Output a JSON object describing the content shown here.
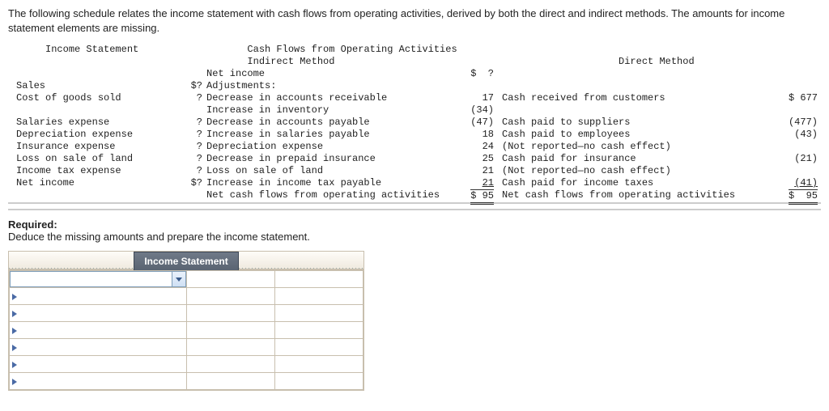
{
  "intro": "The following schedule relates the income statement with cash flows from operating activities, derived by both the direct and indirect methods. The amounts for income statement elements are missing.",
  "titles": {
    "cashflows": "Cash Flows from Operating Activities",
    "indirect": "Indirect Method",
    "direct": "Direct Method",
    "income_statement": "Income Statement"
  },
  "income_statement": {
    "rows": [
      {
        "label": "Sales",
        "value": "$?"
      },
      {
        "label": "Cost of goods sold",
        "value": "?"
      },
      {
        "label": "Salaries expense",
        "value": "?"
      },
      {
        "label": "Depreciation expense",
        "value": "?"
      },
      {
        "label": "Insurance expense",
        "value": "?"
      },
      {
        "label": "Loss on sale of land",
        "value": "?"
      },
      {
        "label": "Income tax expense",
        "value": "?"
      },
      {
        "label": "Net income",
        "value": "$?"
      }
    ]
  },
  "indirect": {
    "lines": [
      {
        "label": "Net income",
        "value": "$  ?"
      },
      {
        "label": "Adjustments:",
        "value": ""
      },
      {
        "label": "Decrease in accounts receivable",
        "value": "17"
      },
      {
        "label": "Increase in inventory",
        "value": "(34)"
      },
      {
        "label": "Decrease in accounts payable",
        "value": "(47)"
      },
      {
        "label": "Increase in salaries payable",
        "value": "18"
      },
      {
        "label": "Depreciation expense",
        "value": "24"
      },
      {
        "label": "Decrease in prepaid insurance",
        "value": "25"
      },
      {
        "label": "Loss on sale of land",
        "value": "21"
      },
      {
        "label": "Increase in income tax payable",
        "value": "21"
      },
      {
        "label": "Net cash flows from operating activities",
        "value": "$ 95"
      }
    ]
  },
  "direct": {
    "lines": [
      {
        "label": "Cash received from customers",
        "value": "$ 677"
      },
      {
        "label": "Cash paid to suppliers",
        "value": "(477)"
      },
      {
        "label": "Cash paid to employees",
        "value": "(43)"
      },
      {
        "label": "(Not reported—no cash effect)",
        "value": ""
      },
      {
        "label": "Cash paid for insurance",
        "value": "(21)"
      },
      {
        "label": "(Not reported—no cash effect)",
        "value": ""
      },
      {
        "label": "Cash paid for income taxes",
        "value": "(41)"
      },
      {
        "label": "Net cash flows from operating activities",
        "value": "$  95"
      }
    ]
  },
  "required": {
    "heading": "Required:",
    "text": "Deduce the missing amounts and prepare the income statement."
  },
  "tab": {
    "label": "Income Statement"
  }
}
